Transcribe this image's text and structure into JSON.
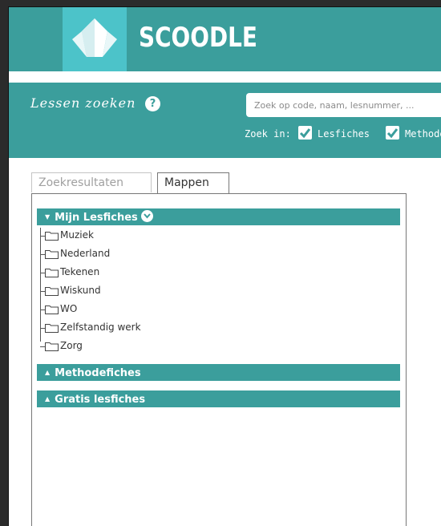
{
  "app": {
    "brand": "SCOODLE"
  },
  "search": {
    "title": "Lessen zoeken",
    "help": "?",
    "placeholder": "Zoek op code, naam, lesnummer, ...",
    "zoek_in_label": "Zoek in:",
    "filters": [
      {
        "label": "Lesfiches",
        "checked": true
      },
      {
        "label": "Methodefiches",
        "checked": true
      }
    ]
  },
  "tabs": [
    {
      "label": "Zoekresultaten",
      "active": false
    },
    {
      "label": "Mappen",
      "active": true
    }
  ],
  "sections": [
    {
      "title": "Mijn Lesfiches",
      "expanded": true,
      "folders": [
        "Muziek",
        "Nederland",
        "Tekenen",
        "Wiskund",
        "WO",
        "Zelfstandig werk",
        "Zorg"
      ]
    },
    {
      "title": "Methodefiches",
      "expanded": false
    },
    {
      "title": "Gratis lesfiches",
      "expanded": false
    }
  ],
  "colors": {
    "teal": "#3b9e9c",
    "logo_teal": "#4cc3c9",
    "white": "#ffffff"
  }
}
